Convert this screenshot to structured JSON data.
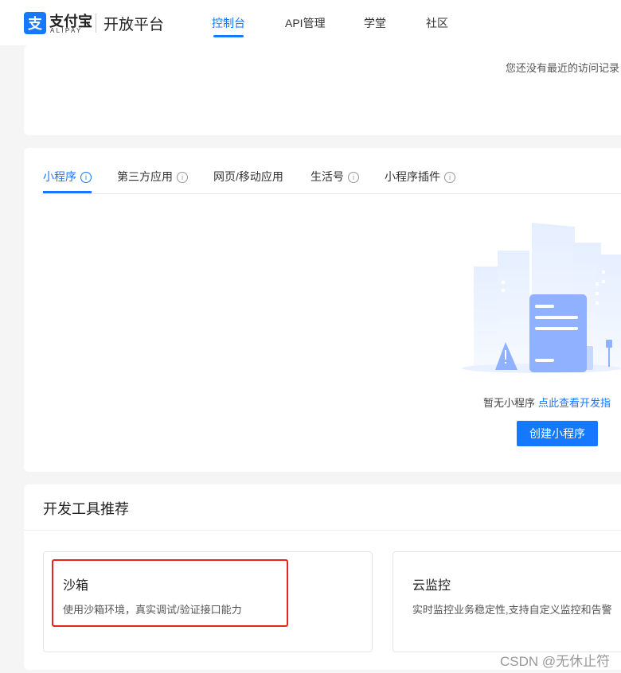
{
  "header": {
    "logo_cn": "支付宝",
    "logo_en": "ALIPAY",
    "platform": "开放平台",
    "nav": [
      {
        "label": "控制台",
        "active": true
      },
      {
        "label": "API管理",
        "active": false
      },
      {
        "label": "学堂",
        "active": false
      },
      {
        "label": "社区",
        "active": false
      }
    ]
  },
  "recent": {
    "empty_text": "您还没有最近的访问记录"
  },
  "apps": {
    "tabs": [
      {
        "label": "小程序",
        "active": true
      },
      {
        "label": "第三方应用",
        "active": false
      },
      {
        "label": "网页/移动应用",
        "active": false
      },
      {
        "label": "生活号",
        "active": false
      },
      {
        "label": "小程序插件",
        "active": false
      }
    ],
    "info_glyph": "i",
    "empty_text": "暂无小程序",
    "empty_link": "点此查看开发指",
    "create_button": "创建小程序"
  },
  "tools": {
    "title": "开发工具推荐",
    "items": [
      {
        "name": "沙箱",
        "desc": "使用沙箱环境，真实调试/验证接口能力"
      },
      {
        "name": "云监控",
        "desc": "实时监控业务稳定性,支持自定义监控和告警"
      }
    ]
  },
  "watermark": "CSDN @无休止符",
  "colors": {
    "accent": "#1677ff",
    "highlight": "#e8241c",
    "background": "#f5f5f5"
  }
}
